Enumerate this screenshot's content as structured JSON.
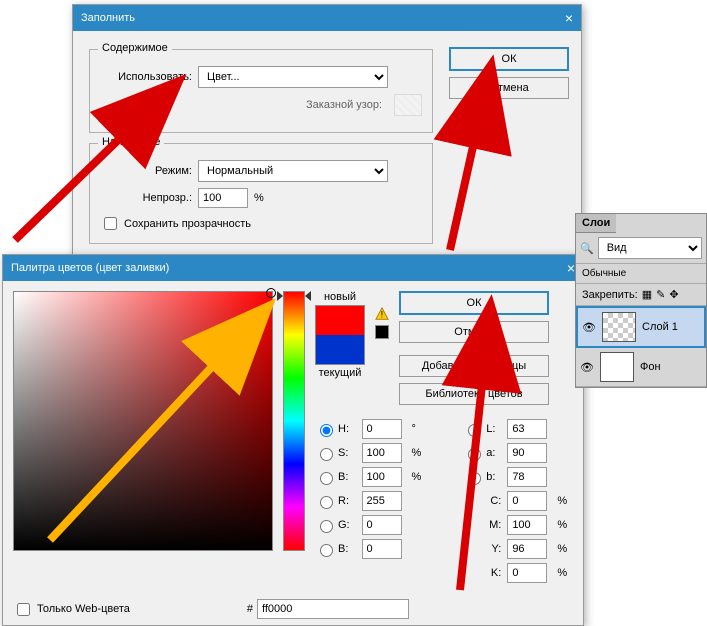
{
  "fill": {
    "title": "Заполнить",
    "contents_legend": "Содержимое",
    "use_label": "Использовать:",
    "use_value": "Цвет...",
    "custom_pattern": "Заказной узор:",
    "blending_legend": "Наложение",
    "mode_label": "Режим:",
    "mode_value": "Нормальный",
    "opacity_label": "Непрозр.:",
    "opacity_value": "100",
    "percent": "%",
    "preserve": "Сохранить прозрачность",
    "ok": "ОК",
    "cancel": "Отмена"
  },
  "picker": {
    "title": "Палитра цветов (цвет заливки)",
    "new_label": "новый",
    "current_label": "текущий",
    "ok": "ОК",
    "cancel": "Отмена",
    "add": "Добавить в образцы",
    "libraries": "Библиотеки цветов",
    "only_web": "Только Web-цвета",
    "hex_prefix": "#",
    "hex": "ff0000",
    "H": "H:",
    "H_val": "0",
    "deg": "°",
    "S": "S:",
    "S_val": "100",
    "pct": "%",
    "Bv": "B:",
    "Bv_val": "100",
    "R": "R:",
    "R_val": "255",
    "G": "G:",
    "G_val": "0",
    "Bb": "B:",
    "Bb_val": "0",
    "L": "L:",
    "L_val": "63",
    "a": "a:",
    "a_val": "90",
    "b": "b:",
    "b_val": "78",
    "C": "C:",
    "C_val": "0",
    "M": "M:",
    "M_val": "100",
    "Y": "Y:",
    "Y_val": "96",
    "K": "K:",
    "K_val": "0"
  },
  "layers": {
    "title": "Слои",
    "kind": "Вид",
    "state": "Обычные",
    "lock": "Закрепить:",
    "layer1": "Слой 1",
    "bg": "Фон"
  }
}
